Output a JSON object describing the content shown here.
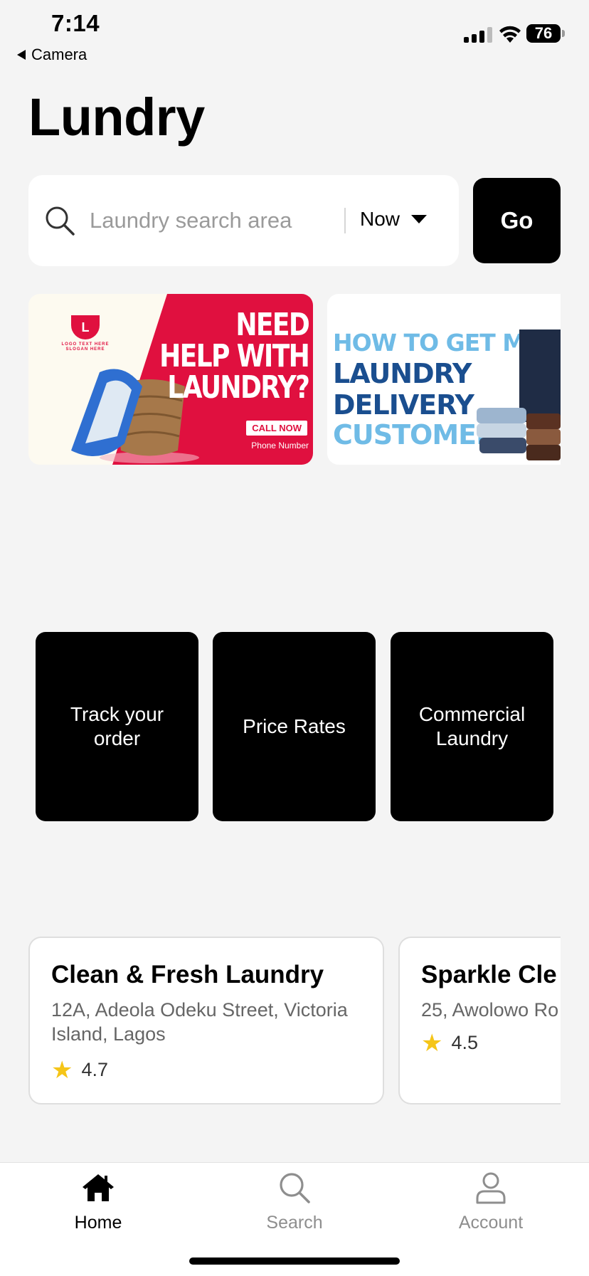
{
  "status_bar": {
    "time": "7:14",
    "back_label": "Camera",
    "battery": "76"
  },
  "header": {
    "title": "Lundry"
  },
  "search": {
    "placeholder": "Laundry search area",
    "time_option": "Now",
    "go_label": "Go"
  },
  "banners": [
    {
      "logo_letter": "L",
      "logo_text": "LOGO TEXT HERE",
      "slogan_text": "SLOGAN HERE",
      "headline_line1": "NEED",
      "headline_line2": "HELP WITH",
      "headline_line3": "LAUNDRY?",
      "cta": "CALL NOW",
      "phone": "Phone Number",
      "accent_color": "#e0103f"
    },
    {
      "line1": "HOW TO GET MOR",
      "line2": "LAUNDRY",
      "line3": "DELIVERY",
      "line4": "CUSTOMERS",
      "accent_color": "#1a4e8f"
    }
  ],
  "quick_actions": [
    {
      "label": "Track your order"
    },
    {
      "label": "Price Rates"
    },
    {
      "label": "Commercial Laundry"
    }
  ],
  "laundries": [
    {
      "name": "Clean & Fresh Laundry",
      "address": "12A, Adeola Odeku Street, Victoria Island, Lagos",
      "rating": "4.7"
    },
    {
      "name": "Sparkle Cle",
      "address": "25, Awolowo Ro",
      "rating": "4.5"
    }
  ],
  "tabs": [
    {
      "label": "Home",
      "icon": "house-icon",
      "active": true
    },
    {
      "label": "Search",
      "icon": "search-icon",
      "active": false
    },
    {
      "label": "Account",
      "icon": "person-icon",
      "active": false
    }
  ],
  "colors": {
    "star": "#f5c518",
    "tile": "#000000",
    "background": "#f4f4f4"
  }
}
